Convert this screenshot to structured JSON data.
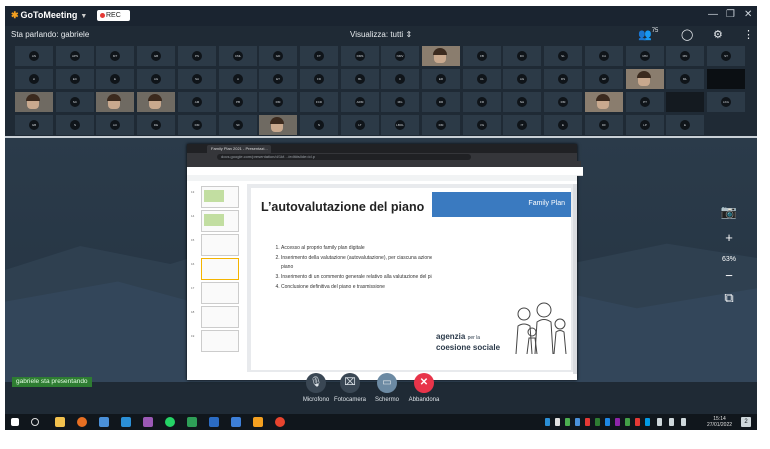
{
  "titlebar": {
    "app_name": "GoToMeeting",
    "rec_label": "REC"
  },
  "subbar": {
    "speaking_label": "Sta parlando: gabriele",
    "view_label": "Visualizza: tutti",
    "participants_count": "75"
  },
  "attendee_initials": [
    "AN",
    "APS",
    "MT",
    "GB",
    "PS",
    "CML",
    "GD",
    "FT",
    "DMS",
    "NMV",
    "",
    "FB",
    "DC",
    "SL",
    "CA",
    "MM",
    "MN",
    "ST",
    "LI",
    "EC",
    "E",
    "AG",
    "SA",
    "A",
    "ET",
    "FD",
    "BL",
    "C",
    "ER",
    "CL",
    "AG",
    "RS",
    "GP",
    "",
    "ML",
    "",
    "",
    "SC",
    "",
    "",
    "AM",
    "PB",
    "RM",
    "FCD",
    "ARM",
    "MG",
    "DR",
    "FR",
    "NH",
    "RM",
    "",
    "PT",
    "",
    "LKG",
    "GB",
    "S",
    "AU",
    "DE",
    "DM",
    "SF",
    "",
    "N",
    "LT",
    "LBOL",
    "DM",
    "VG",
    "IT",
    "E",
    "DF",
    "LP",
    "E"
  ],
  "slide": {
    "title": "L’autovalutazione del piano",
    "band_text": "Family Plan",
    "items": [
      "Accesso al proprio family plan digitale",
      "Inserimento della valutazione (autovalutazione), per ciascuna azione del piano",
      "Inserimento di un commento generale relativo alla valutazione del piano",
      "Conclusione definitiva del piano e trasmissione"
    ],
    "agency_line1": "agenzia",
    "agency_small": "per la",
    "agency_line2": "coesione sociale"
  },
  "browser": {
    "tab_label": "Family Plan 2021 - Presentazi...",
    "url": "docs.google.com/presentation/d/1kf…/edit#slide=id.p"
  },
  "zoom_level": "63%",
  "presenting_label": "gabriele sta presentando",
  "controls": {
    "mic": "Microfono",
    "camera": "Fotocamera",
    "screen": "Schermo",
    "leave": "Abbandona"
  },
  "clock": {
    "time": "15:14",
    "date": "27/01/2022"
  },
  "notification_count": "2",
  "colors": {
    "app_bg": "#1f2a35",
    "accent_blue": "#3a7ac0",
    "leave_red": "#e8344a",
    "presenting_green": "#2e7d32"
  }
}
